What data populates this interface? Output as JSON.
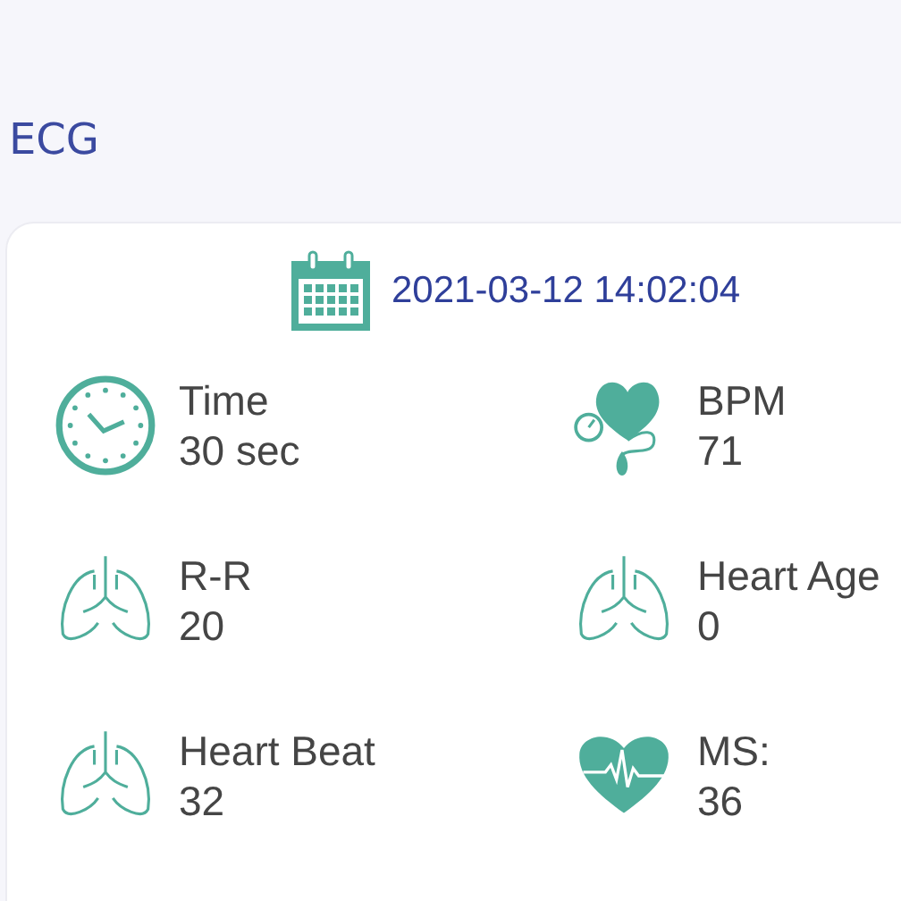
{
  "page_title": "ECG",
  "record": {
    "datetime": "2021-03-12 14:02:04"
  },
  "metrics": [
    {
      "kind": "clock",
      "label": "Time",
      "value": "30 sec"
    },
    {
      "kind": "heart-gauge",
      "label": "BPM",
      "value": "71"
    },
    {
      "kind": "lungs",
      "label": "R-R",
      "value": "20"
    },
    {
      "kind": "lungs",
      "label": "Heart Age",
      "value": "0"
    },
    {
      "kind": "lungs",
      "label": "Heart Beat",
      "value": "32"
    },
    {
      "kind": "heart-pulse",
      "label": "MS:",
      "value": "36"
    }
  ]
}
